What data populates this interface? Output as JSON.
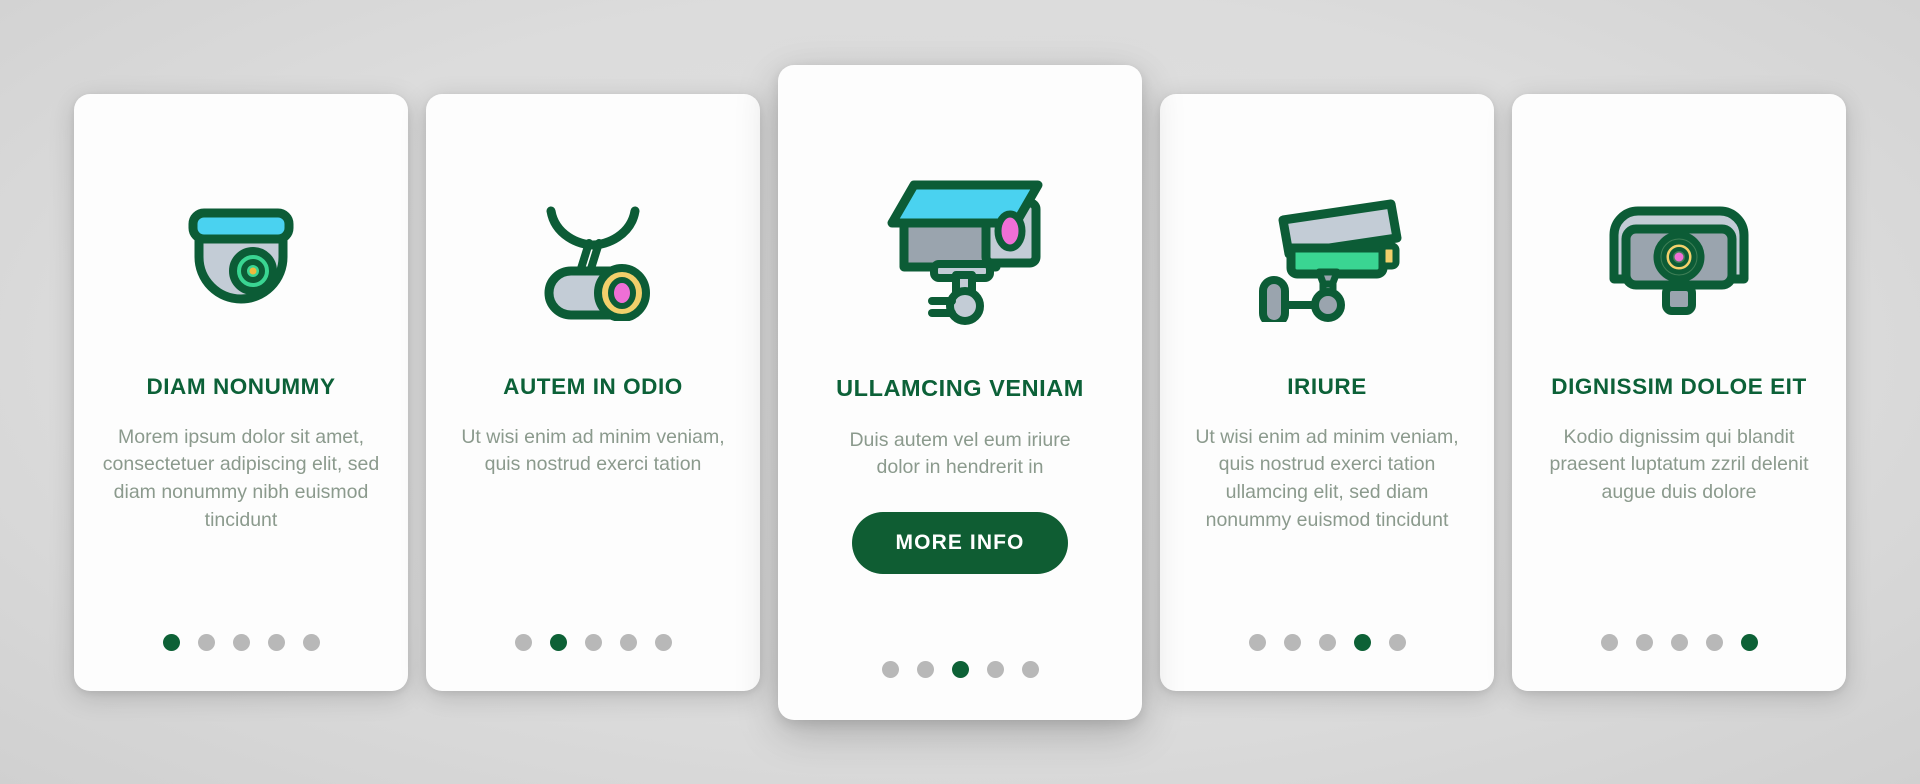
{
  "theme": {
    "brand_green": "#0c6138",
    "button_green": "#0f5d33",
    "body_text_gray": "#8b9a8d",
    "dot_inactive": "#b8b8b8",
    "dot_active": "#0d6136",
    "card_background": "#fdfdfd",
    "page_background": "#cfcfcf",
    "icon_cyan": "#4ad2f0",
    "icon_gray_blue": "#c3ccd6",
    "icon_green": "#3ad592",
    "icon_yellow": "#f2d06b",
    "icon_pink": "#ef6fd6",
    "icon_outline": "#0c5c36"
  },
  "cards": [
    {
      "icon_name": "dome-security-camera-icon",
      "title": "DIAM NONUMMY",
      "body": "Morem ipsum dolor sit amet, consectetuer adipiscing elit, sed diam nonummy nibh euismod tincidunt",
      "dots": {
        "count": 5,
        "active_index": 0
      },
      "has_button": false,
      "featured": false
    },
    {
      "icon_name": "hanging-ceiling-camera-icon",
      "title": "AUTEM IN ODIO",
      "body": "Ut wisi enim ad minim veniam, quis nostrud exerci tation",
      "dots": {
        "count": 5,
        "active_index": 1
      },
      "has_button": false,
      "featured": false
    },
    {
      "icon_name": "box-cctv-camera-icon",
      "title": "ULLAMCING VENIAM",
      "body": "Duis autem vel eum iriure dolor in hendrerit in",
      "button_label": "MORE INFO",
      "dots": {
        "count": 5,
        "active_index": 2
      },
      "has_button": true,
      "featured": true
    },
    {
      "icon_name": "wall-mounted-cctv-camera-icon",
      "title": "IRIURE",
      "body": "Ut wisi enim ad minim veniam, quis nostrud exerci tation ullamcing elit, sed diam nonummy euismod tincidunt",
      "dots": {
        "count": 5,
        "active_index": 3
      },
      "has_button": false,
      "featured": false
    },
    {
      "icon_name": "front-facing-camera-icon",
      "title": "DIGNISSIM DOLOE EIT",
      "body": "Kodio dignissim qui blandit praesent luptatum zzril delenit augue duis dolore",
      "dots": {
        "count": 5,
        "active_index": 4
      },
      "has_button": false,
      "featured": false
    }
  ]
}
